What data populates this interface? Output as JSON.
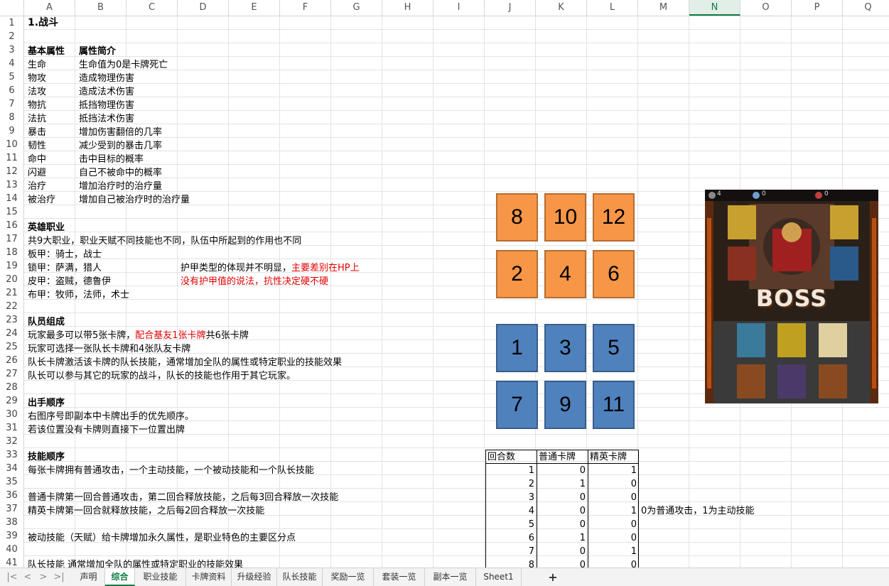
{
  "columns": [
    "A",
    "B",
    "C",
    "D",
    "E",
    "F",
    "G",
    "H",
    "I",
    "J",
    "K",
    "L",
    "M",
    "N",
    "O",
    "P",
    "Q"
  ],
  "selected_column": "N",
  "rows": [
    "1",
    "2",
    "3",
    "4",
    "5",
    "6",
    "7",
    "8",
    "9",
    "10",
    "11",
    "12",
    "13",
    "14",
    "15",
    "16",
    "17",
    "18",
    "19",
    "20",
    "21",
    "22",
    "23",
    "24",
    "25",
    "26",
    "27",
    "28",
    "29",
    "30",
    "31",
    "32",
    "33",
    "34",
    "35",
    "36",
    "37",
    "38",
    "39",
    "40",
    "41"
  ],
  "cells": {
    "r1": "1.战斗",
    "r3a": "基本属性",
    "r3b": "属性简介",
    "attrs": [
      {
        "name": "生命",
        "desc": "生命值为0是卡牌死亡"
      },
      {
        "name": "物攻",
        "desc": "造成物理伤害"
      },
      {
        "name": "法攻",
        "desc": "造成法术伤害"
      },
      {
        "name": "物抗",
        "desc": "抵挡物理伤害"
      },
      {
        "name": "法抗",
        "desc": "抵挡法术伤害"
      },
      {
        "name": "暴击",
        "desc": "增加伤害翻倍的几率"
      },
      {
        "name": "韧性",
        "desc": "减少受到的暴击几率"
      },
      {
        "name": "命中",
        "desc": "击中目标的概率"
      },
      {
        "name": "闪避",
        "desc": "自己不被命中的概率"
      },
      {
        "name": "治疗",
        "desc": "增加治疗时的治疗量"
      },
      {
        "name": "被治疗",
        "desc": "增加自己被治疗时的治疗量"
      }
    ],
    "r16": "英雄职业",
    "r17": "共9大职业，职业天赋不同技能也不同，队伍中所起到的作用也不同",
    "r18": "板甲：骑士，战士",
    "r19": "锁甲：萨满，猎人",
    "r19e1": "护甲类型的体现并不明显，",
    "r19e2": "主要差别在HP上",
    "r20": "皮甲：盗贼，德鲁伊",
    "r20e": "没有护甲值的说法，抗性决定硬不硬",
    "r21": "布甲：牧师，法师，术士",
    "r23": "队员组成",
    "r24a": "玩家最多可以带5张卡牌，",
    "r24b": "配合基友1张卡牌",
    "r24c": "共6张卡牌",
    "r25": "玩家可选择一张队长卡牌和4张队友卡牌",
    "r26": "队长卡牌激活该卡牌的队长技能，通常增加全队的属性或特定职业的技能效果",
    "r27": "队长可以参与其它的玩家的战斗，队长的技能也作用于其它玩家。",
    "r29": "出手顺序",
    "r30": "右图序号即副本中卡牌出手的优先顺序。",
    "r31": "若该位置没有卡牌则直接下一位置出牌",
    "r33": "技能顺序",
    "r34": "每张卡牌拥有普通攻击，一个主动技能，一个被动技能和一个队长技能",
    "r36": "普通卡牌第一回合普通攻击，第二回合释放技能，之后每3回合释放一次技能",
    "r37": "精英卡牌第一回合就释放技能，之后每2回合释放一次技能",
    "r37n": "0为普通攻击，1为主动技能",
    "r39": "被动技能（天赋）给卡牌增加永久属性，是职业特色的主要区分点",
    "r41": "队长技能 通常增加全队的属性或特定职业的技能效果"
  },
  "order_boxes": {
    "top": [
      [
        "8",
        "10",
        "12"
      ],
      [
        "2",
        "4",
        "6"
      ]
    ],
    "bottom": [
      [
        "1",
        "3",
        "5"
      ],
      [
        "7",
        "9",
        "11"
      ]
    ],
    "top_color": "#f79646",
    "bottom_color": "#4f81bd"
  },
  "round_table": {
    "headers": [
      "回合数",
      "普通卡牌",
      "精英卡牌"
    ],
    "rows": [
      [
        "1",
        "0",
        "1"
      ],
      [
        "2",
        "1",
        "0"
      ],
      [
        "3",
        "0",
        "0"
      ],
      [
        "4",
        "0",
        "1"
      ],
      [
        "5",
        "0",
        "0"
      ],
      [
        "6",
        "1",
        "0"
      ],
      [
        "7",
        "0",
        "1"
      ],
      [
        "8",
        "0",
        "0"
      ]
    ]
  },
  "image_text": "BOSS",
  "image_icons": {
    "counter_1": "4",
    "counter_2": "0",
    "counter_3": "0"
  },
  "sheet_tabs": [
    "声明",
    "综合",
    "职业技能",
    "卡牌资料",
    "升级经验",
    "队长技能",
    "奖励一览",
    "套装一览",
    "副本一览",
    "Sheet1"
  ],
  "active_tab": "综合",
  "add_sheet": "+"
}
